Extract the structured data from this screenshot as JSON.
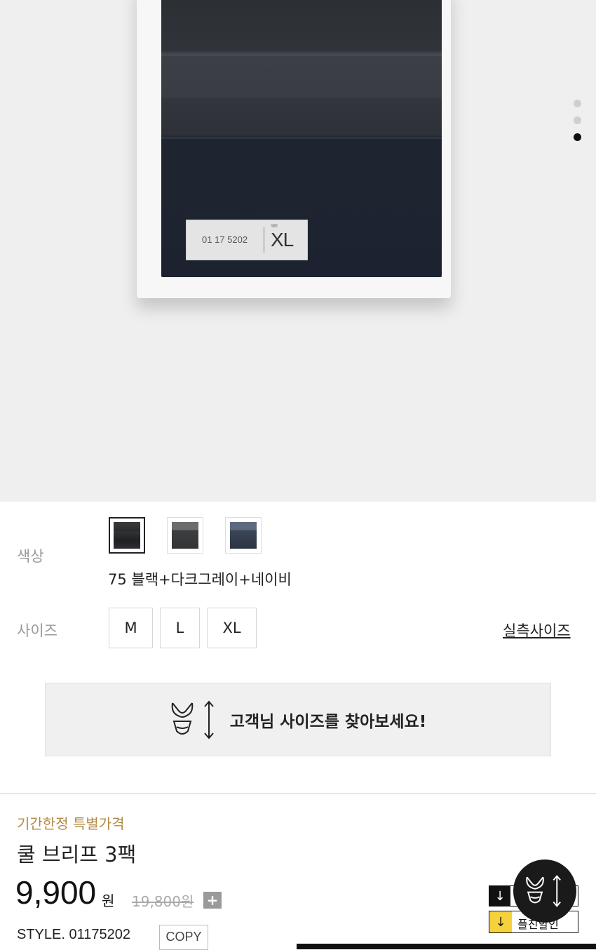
{
  "product_image": {
    "tag_code": "01 17 5202",
    "tag_size_small": "SIZE",
    "tag_size": "XL",
    "carousel_total": 3,
    "carousel_active_index": 3
  },
  "options": {
    "color_label": "색상",
    "color_swatches": [
      {
        "name": "swatch-1",
        "fill": "#2e2f31"
      },
      {
        "name": "swatch-2",
        "fill": "#444546"
      },
      {
        "name": "swatch-3",
        "fill": "#3e4656"
      }
    ],
    "selected_color": "75 블랙+다크그레이+네이비",
    "size_label": "사이즈",
    "sizes": [
      "M",
      "L",
      "XL"
    ],
    "size_chart_link": "실측사이즈"
  },
  "size_finder": {
    "text": "고객님 사이즈를 찾아보세요!"
  },
  "product": {
    "promo": "기간한정 특별가격",
    "title": "쿨 브리프 3팩",
    "price": "9,900",
    "currency": "원",
    "original_price": "19,800원",
    "plus_symbol": "+",
    "style_code": "STYLE. 01175202",
    "copy_button": "COPY"
  },
  "coupons": {
    "coupon2_text": "플친할인",
    "download_symbol": "↓"
  },
  "colors": {
    "promo": "#b38a45",
    "coupon_yellow": "#f5d23c"
  }
}
